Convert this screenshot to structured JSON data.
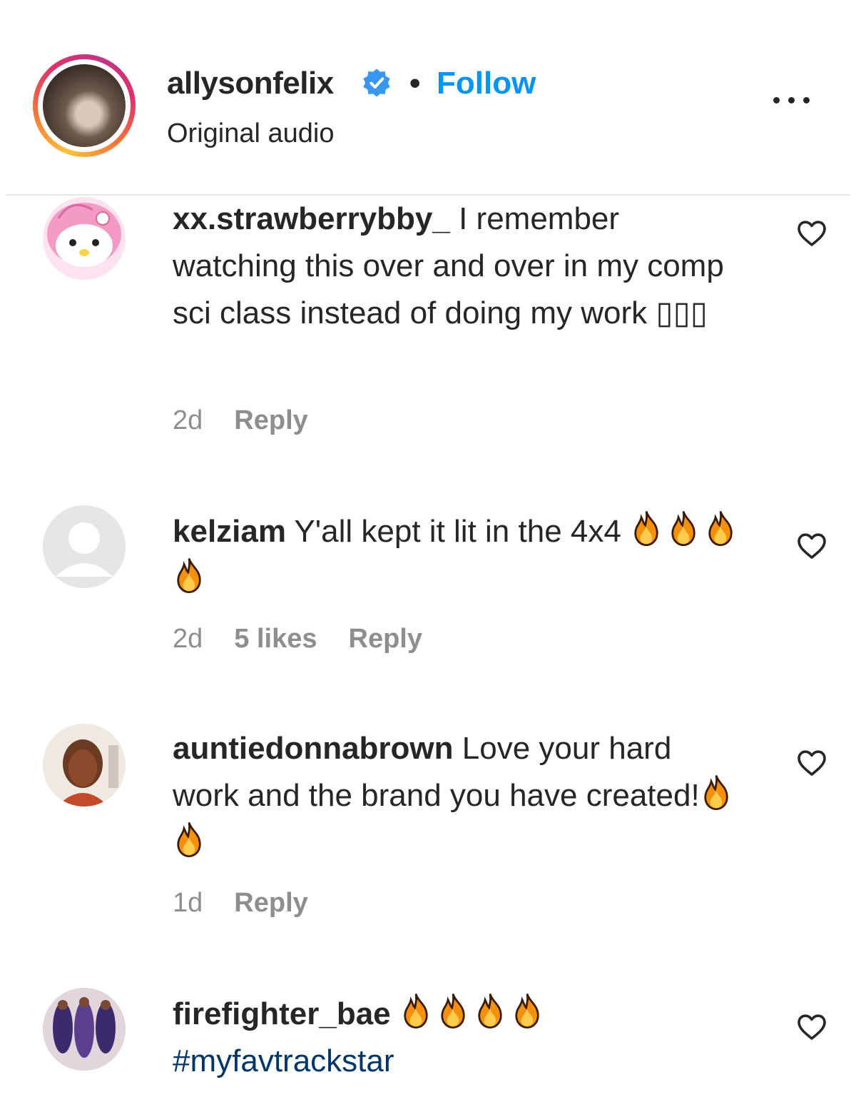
{
  "header": {
    "username": "allysonfelix",
    "separator": "•",
    "follow_label": "Follow",
    "subtitle": "Original audio",
    "more_icon": "more-horizontal-icon"
  },
  "colors": {
    "follow": "#0095f6",
    "meta": "#8e8e8e",
    "hashtag": "#00376b",
    "text": "#262626"
  },
  "comments": [
    {
      "username": "xx.strawberrybby_",
      "text": "I remember watching this over and over in my comp sci class instead of doing my work ▯▯▯",
      "time": "2d",
      "likes": "",
      "reply_label": "Reply"
    },
    {
      "username": "kelziam",
      "text": "Y'all kept it lit in the 4x4",
      "emoji_count": 4,
      "time": "2d",
      "likes": "5 likes",
      "reply_label": "Reply"
    },
    {
      "username": "auntiedonnabrown",
      "text": "Love your hard work and the brand you have created!",
      "emoji_count": 2,
      "time": "1d",
      "likes": "",
      "reply_label": "Reply"
    },
    {
      "username": "firefighter_bae",
      "emoji_count": 4,
      "hashtag": "#myfavtrackstar"
    }
  ]
}
